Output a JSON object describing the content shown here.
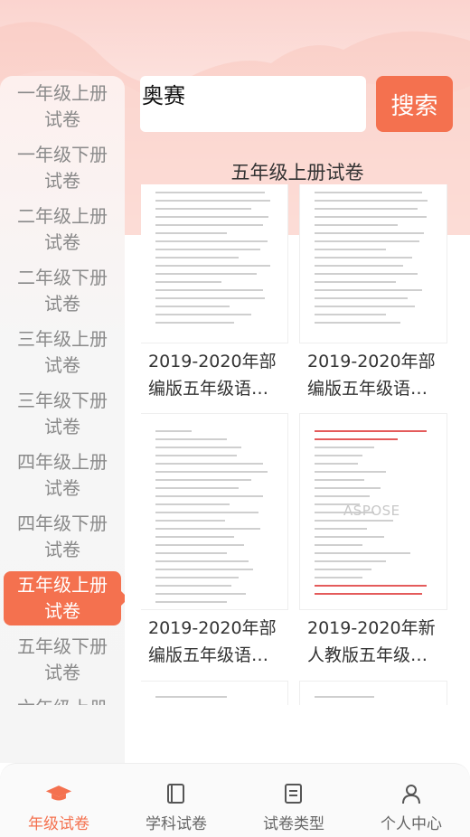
{
  "search": {
    "value": "奥赛",
    "button_label": "搜索"
  },
  "sidebar": {
    "items": [
      {
        "label": "一年级上册试卷",
        "active": false
      },
      {
        "label": "一年级下册试卷",
        "active": false
      },
      {
        "label": "二年级上册试卷",
        "active": false
      },
      {
        "label": "二年级下册试卷",
        "active": false
      },
      {
        "label": "三年级上册试卷",
        "active": false
      },
      {
        "label": "三年级下册试卷",
        "active": false
      },
      {
        "label": "四年级上册试卷",
        "active": false
      },
      {
        "label": "四年级下册试卷",
        "active": false
      },
      {
        "label": "五年级上册试卷",
        "active": true
      },
      {
        "label": "五年级下册试卷",
        "active": false
      },
      {
        "label": "六年级上册试卷",
        "active": false
      }
    ]
  },
  "main": {
    "section_title": "五年级上册试卷",
    "cards": [
      {
        "title": "2019-2020年部编版五年级语…"
      },
      {
        "title": "2019-2020年部编版五年级语…"
      },
      {
        "title": "2019-2020年部编版五年级语…"
      },
      {
        "title": "2019-2020年新人教版五年级…",
        "watermark": "ASPOSE"
      },
      {
        "title": ""
      },
      {
        "title": ""
      }
    ]
  },
  "tabbar": {
    "tabs": [
      {
        "label": "年级试卷",
        "icon": "graduation-cap-icon",
        "active": true
      },
      {
        "label": "学科试卷",
        "icon": "book-icon",
        "active": false
      },
      {
        "label": "试卷类型",
        "icon": "document-list-icon",
        "active": false
      },
      {
        "label": "个人中心",
        "icon": "person-icon",
        "active": false
      }
    ]
  },
  "colors": {
    "accent": "#f4714f",
    "header_pink": "#fbd4cf",
    "text_gray": "#8a8a8a"
  }
}
